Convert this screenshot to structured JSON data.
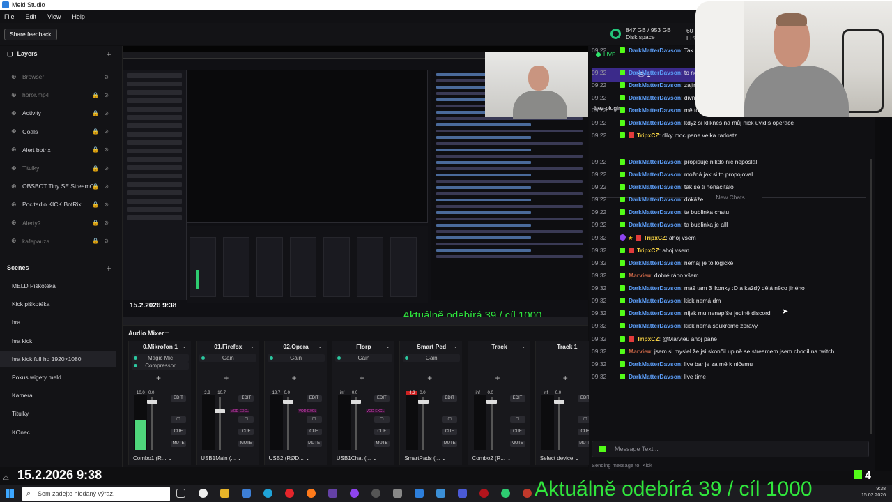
{
  "window": {
    "title": "Meld Studio",
    "controls": [
      "–",
      "▢",
      "✕"
    ]
  },
  "menu": [
    "File",
    "Edit",
    "View",
    "Help"
  ],
  "topbar": {
    "feedback_label": "Share feedback",
    "disk_value": "847 GB / 953 GB",
    "disk_label": "Disk space",
    "fps_value": "60",
    "fps_label": "FPS"
  },
  "layers": {
    "title": "Layers",
    "items": [
      {
        "label": "Browser",
        "locked": false,
        "dim": true
      },
      {
        "label": "horor.mp4",
        "locked": true,
        "dim": true
      },
      {
        "label": "Activity",
        "locked": true,
        "dim": false
      },
      {
        "label": "Goals",
        "locked": true,
        "dim": false
      },
      {
        "label": "Alert botrix",
        "locked": true,
        "dim": false
      },
      {
        "label": "Titulky",
        "locked": true,
        "dim": true
      },
      {
        "label": "OBSBOT Tiny SE StreamC...",
        "locked": true,
        "dim": false
      },
      {
        "label": "Pocitadlo KICK BotRix",
        "locked": true,
        "dim": false
      },
      {
        "label": "Alerty?",
        "locked": true,
        "dim": true
      },
      {
        "label": "kafepauza",
        "locked": true,
        "dim": true
      }
    ]
  },
  "scenes": {
    "title": "Scenes",
    "items": [
      "MELD Piškotéka",
      "Kick piškotéka",
      "hra",
      "hra kick",
      "hra kick full hd 1920×1080",
      "Pokus wigety meld",
      "Kamera",
      "Titulky",
      "KOnec"
    ],
    "active_index": 4
  },
  "preview": {
    "date": "15.2.2026 9:38",
    "ticker": "Aktuálně odebírá 39 / cíl 1000"
  },
  "mixer": {
    "title": "Audio Mixer",
    "strips": [
      {
        "name": "0.Mikrofon 1",
        "fx": [
          "Magic Mic",
          "Compressor"
        ],
        "db_left": "-10.0",
        "db_right": "0.0",
        "level": 0.55,
        "fader": 0.95,
        "device": "Combo1 (R...",
        "vod": false,
        "peak": false
      },
      {
        "name": "01.Firefox",
        "fx": [
          "Gain"
        ],
        "db_left": "-2.9",
        "db_right": "-10.7",
        "level": 0.0,
        "fader": 0.75,
        "device": "USB1Main (...",
        "vod": true,
        "peak": false
      },
      {
        "name": "02.Opera",
        "fx": [
          "Gain"
        ],
        "db_left": "-12.7",
        "db_right": "0.0",
        "level": 0.0,
        "fader": 0.95,
        "device": "USB2 (RØD...",
        "vod": true,
        "peak": false
      },
      {
        "name": "Florp",
        "fx": [
          "Gain"
        ],
        "db_left": "-inf",
        "db_right": "0.0",
        "level": 0.0,
        "fader": 0.95,
        "device": "USB1Chat (...",
        "vod": true,
        "peak": false
      },
      {
        "name": "Smart Ped",
        "fx": [
          "Gain"
        ],
        "db_left": "-4.2",
        "db_right": "0.0",
        "level": 0.0,
        "fader": 0.95,
        "device": "SmartPads (...",
        "vod": false,
        "peak": true
      },
      {
        "name": "Track",
        "fx": [],
        "db_left": "-inf",
        "db_right": "0.0",
        "level": 0.0,
        "fader": 0.95,
        "device": "Combo2 (R...",
        "vod": false,
        "peak": false
      },
      {
        "name": "Track 1",
        "fx": [],
        "db_left": "-inf",
        "db_right": "0.0",
        "level": 0.0,
        "fader": 0.95,
        "device": "Select device",
        "vod": false,
        "peak": false
      }
    ],
    "btn_edit": "EDIT",
    "btn_cue": "CUE",
    "btn_mute": "MUTE",
    "vod_label": "VOD-EXCL"
  },
  "bottom_date": "15.2.2026 9:38",
  "chat": {
    "live_label": "LIVE",
    "viewers": "1",
    "wrap_text": "bez pluginu",
    "new_chats": "New Chats",
    "messages": [
      {
        "time": "09:22",
        "user": "DarkMatterDavson",
        "kind": "dm",
        "text": ": Tak halvne"
      },
      {
        "time": "09:22",
        "user": "DarkMatterDavson",
        "kind": "dm",
        "text": ": to neuvidíš ale je to jeden z těch propacovanějších multi chatů"
      },
      {
        "time": "09:22",
        "user": "DarkMatterDavson",
        "kind": "dm",
        "text": ": zajímavé že se tam teď neposlala zpráva"
      },
      {
        "time": "09:22",
        "user": "DarkMatterDavson",
        "kind": "dm",
        "text": ": divný"
      },
      {
        "time": "09:22",
        "user": "DarkMatterDavson",
        "kind": "dm",
        "text": ": mě to jde v poho"
      },
      {
        "time": "09:22",
        "user": "DarkMatterDavson",
        "kind": "dm",
        "text": ": když si klikneš na můj nick uvidíš operace"
      },
      {
        "time": "09:22",
        "user": "TripxCZ",
        "kind": "tr",
        "text": ": diky moc pane velka radostz"
      },
      {
        "time": "09:22",
        "user": "DarkMatterDavson",
        "kind": "dm",
        "text": ": propisuje nikdo nic neposlal"
      },
      {
        "time": "09:22",
        "user": "DarkMatterDavson",
        "kind": "dm",
        "text": ": možná jak si to propojoval"
      },
      {
        "time": "09:22",
        "user": "DarkMatterDavson",
        "kind": "dm",
        "text": ": tak se ti nenačítalo"
      },
      {
        "time": "09:22",
        "user": "DarkMatterDavson",
        "kind": "dm",
        "text": ": dokáže"
      },
      {
        "time": "09:22",
        "user": "DarkMatterDavson",
        "kind": "dm",
        "text": ": ta bublinka chatu"
      },
      {
        "time": "09:22",
        "user": "DarkMatterDavson",
        "kind": "dm",
        "text": ": ta bublinka je alll"
      },
      {
        "time": "09:32",
        "user": "TripxCZ",
        "kind": "tr3",
        "text": ": ahoj vsem"
      },
      {
        "time": "09:32",
        "user": "TripxCZ",
        "kind": "tr",
        "text": ": ahoj vsem"
      },
      {
        "time": "09:32",
        "user": "DarkMatterDavson",
        "kind": "dm",
        "text": ": nemaj je to logické"
      },
      {
        "time": "09:32",
        "user": "Marvieu",
        "kind": "mv",
        "text": ": dobré ráno všem"
      },
      {
        "time": "09:32",
        "user": "DarkMatterDavson",
        "kind": "dm",
        "text": ": máš tam 3 ikonky :D a každý dělá něco jiného"
      },
      {
        "time": "09:32",
        "user": "DarkMatterDavson",
        "kind": "dm",
        "text": ": kick nemá dm"
      },
      {
        "time": "09:32",
        "user": "DarkMatterDavson",
        "kind": "dm",
        "text": ": nijak mu nenapíše jedině discord"
      },
      {
        "time": "09:32",
        "user": "DarkMatterDavson",
        "kind": "dm",
        "text": ": kick nemá soukromé zprávy"
      },
      {
        "time": "09:32",
        "user": "TripxCZ",
        "kind": "tr",
        "text": ": @Marvieu ahoj pane"
      },
      {
        "time": "09:32",
        "user": "Marvieu",
        "kind": "mv",
        "text": ": jsem si myslel že jsi skončil uplně se streamem jsem chodil na twitch"
      },
      {
        "time": "09:32",
        "user": "DarkMatterDavson",
        "kind": "dm",
        "text": ": live bar je za mě k ničemu"
      },
      {
        "time": "09:32",
        "user": "DarkMatterDavson",
        "kind": "dm",
        "text": ": live time"
      }
    ],
    "input_placeholder": "Message Text...",
    "sending_note": "Sending message to: Kick"
  },
  "taskbar": {
    "search_placeholder": "Sem zadejte hledaný výraz.",
    "time": "9:38",
    "date": "15.02.2026",
    "kick_count": "4"
  },
  "ticker": "Aktuálně odebírá 39 / cíl 1000"
}
